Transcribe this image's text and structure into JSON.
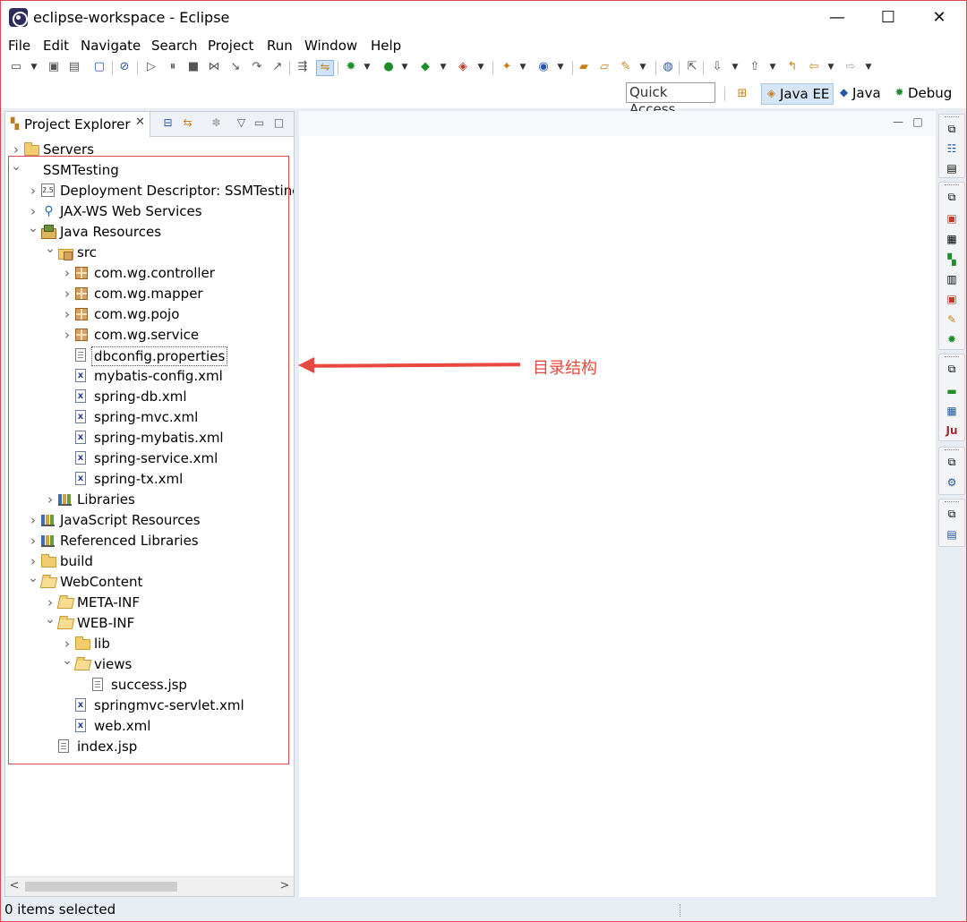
{
  "window": {
    "title": "eclipse-workspace - Eclipse",
    "minimize_glyph": "—",
    "maximize_glyph": "☐",
    "close_glyph": "✕"
  },
  "menu": {
    "items": [
      "File",
      "Edit",
      "Navigate",
      "Search",
      "Project",
      "Run",
      "Window",
      "Help"
    ]
  },
  "perspective_bar": {
    "quick_access_placeholder": "Quick Access",
    "perspectives": [
      {
        "label": "Java EE",
        "icon": "java-ee-icon",
        "active": true
      },
      {
        "label": "Java",
        "icon": "java-icon",
        "active": false
      },
      {
        "label": "Debug",
        "icon": "bug-icon",
        "active": false
      }
    ]
  },
  "project_explorer": {
    "tab_label": "Project Explorer",
    "tab_close": "✕",
    "tree": [
      {
        "label": "Servers",
        "icon": "folder",
        "depth": 0,
        "arrow": ">"
      },
      {
        "label": "SSMTesting",
        "icon": "project",
        "depth": 0,
        "arrow": "v"
      },
      {
        "label": "Deployment Descriptor: SSMTesting",
        "icon": "dd",
        "depth": 1,
        "arrow": ">"
      },
      {
        "label": "JAX-WS Web Services",
        "icon": "ws",
        "depth": 1,
        "arrow": ">"
      },
      {
        "label": "Java Resources",
        "icon": "jr",
        "depth": 1,
        "arrow": "v"
      },
      {
        "label": "src",
        "icon": "srcfolder",
        "depth": 2,
        "arrow": "v"
      },
      {
        "label": "com.wg.controller",
        "icon": "pkg",
        "depth": 3,
        "arrow": ">"
      },
      {
        "label": "com.wg.mapper",
        "icon": "pkg",
        "depth": 3,
        "arrow": ">"
      },
      {
        "label": "com.wg.pojo",
        "icon": "pkg",
        "depth": 3,
        "arrow": ">"
      },
      {
        "label": "com.wg.service",
        "icon": "pkg",
        "depth": 3,
        "arrow": ">"
      },
      {
        "label": "dbconfig.properties",
        "icon": "file",
        "depth": 3,
        "arrow": "",
        "selected": true
      },
      {
        "label": "mybatis-config.xml",
        "icon": "xml",
        "depth": 3,
        "arrow": ""
      },
      {
        "label": "spring-db.xml",
        "icon": "xml",
        "depth": 3,
        "arrow": ""
      },
      {
        "label": "spring-mvc.xml",
        "icon": "xml",
        "depth": 3,
        "arrow": ""
      },
      {
        "label": "spring-mybatis.xml",
        "icon": "xml",
        "depth": 3,
        "arrow": ""
      },
      {
        "label": "spring-service.xml",
        "icon": "xml",
        "depth": 3,
        "arrow": ""
      },
      {
        "label": "spring-tx.xml",
        "icon": "xml",
        "depth": 3,
        "arrow": ""
      },
      {
        "label": "Libraries",
        "icon": "lib",
        "depth": 2,
        "arrow": ">"
      },
      {
        "label": "JavaScript Resources",
        "icon": "jsr",
        "depth": 1,
        "arrow": ">"
      },
      {
        "label": "Referenced Libraries",
        "icon": "lib",
        "depth": 1,
        "arrow": ">"
      },
      {
        "label": "build",
        "icon": "folder",
        "depth": 1,
        "arrow": ">"
      },
      {
        "label": "WebContent",
        "icon": "openfolder",
        "depth": 1,
        "arrow": "v"
      },
      {
        "label": "META-INF",
        "icon": "openfolder",
        "depth": 2,
        "arrow": ">"
      },
      {
        "label": "WEB-INF",
        "icon": "openfolder",
        "depth": 2,
        "arrow": "v"
      },
      {
        "label": "lib",
        "icon": "folder",
        "depth": 3,
        "arrow": ">"
      },
      {
        "label": "views",
        "icon": "openfolder",
        "depth": 3,
        "arrow": "v"
      },
      {
        "label": "success.jsp",
        "icon": "file",
        "depth": 4,
        "arrow": ""
      },
      {
        "label": "springmvc-servlet.xml",
        "icon": "xml",
        "depth": 3,
        "arrow": ""
      },
      {
        "label": "web.xml",
        "icon": "xml",
        "depth": 3,
        "arrow": ""
      },
      {
        "label": "index.jsp",
        "icon": "file",
        "depth": 2,
        "arrow": ""
      }
    ]
  },
  "annotation": {
    "text": "目录结构",
    "color": "#e8483f"
  },
  "status_bar": {
    "text": "0 items selected"
  },
  "colors": {
    "window_border": "#e0474f",
    "selection": "#cde3f7"
  }
}
